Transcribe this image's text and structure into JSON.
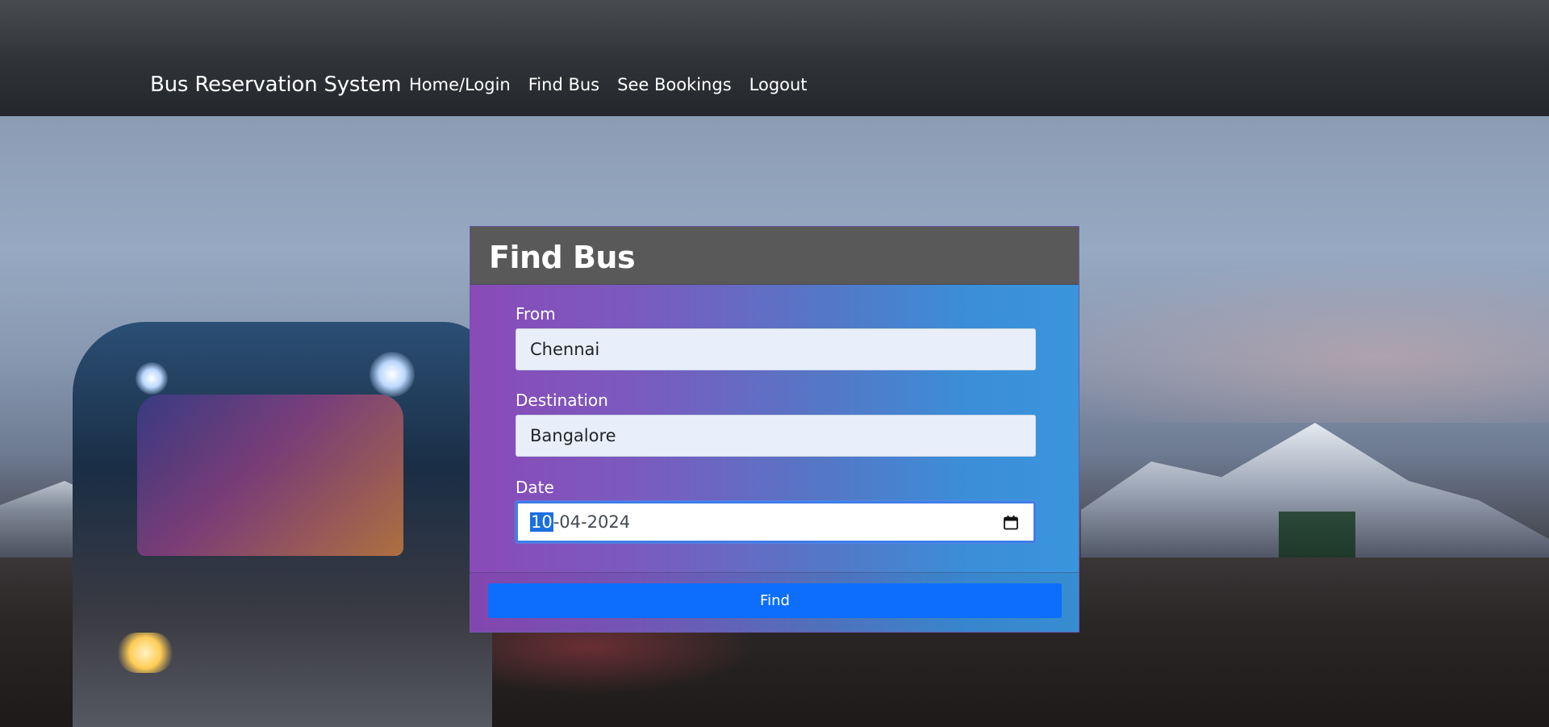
{
  "navbar": {
    "brand": "Bus Reservation System",
    "links": [
      {
        "label": "Home/Login"
      },
      {
        "label": "Find Bus"
      },
      {
        "label": "See Bookings"
      },
      {
        "label": "Logout"
      }
    ]
  },
  "find_bus": {
    "title": "Find Bus",
    "from": {
      "label": "From",
      "value": "Chennai"
    },
    "destination": {
      "label": "Destination",
      "value": "Bangalore"
    },
    "date": {
      "label": "Date",
      "day": "10",
      "rest": "-04-2024",
      "icon": "calendar-icon"
    },
    "button_label": "Find"
  },
  "colors": {
    "navbar": "#2f3236",
    "card_header": "#595959",
    "gradient_start": "#8a4ab8",
    "gradient_end": "#3a95dd",
    "button": "#0d6efd",
    "field_bg": "#e8effb"
  }
}
